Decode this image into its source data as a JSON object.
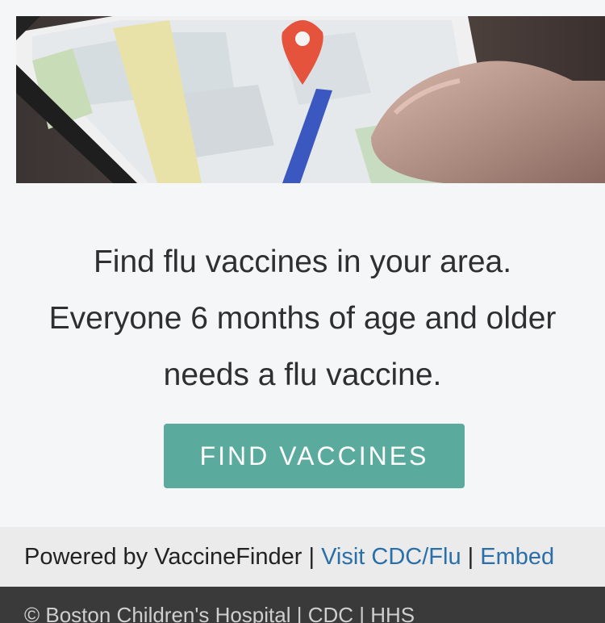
{
  "hero": {
    "image": "phone-map-hero"
  },
  "message": {
    "line1": "Find flu vaccines in your area.",
    "line2": "Everyone 6 months of age and older",
    "line3": "needs a flu vaccine."
  },
  "cta": {
    "label": "FIND VACCINES",
    "color": "#5aab9d"
  },
  "powered_bar": {
    "prefix": "Powered by VaccineFinder",
    "sep1": " | ",
    "link_cdc": "Visit CDC/Flu",
    "sep2": " | ",
    "link_embed": "Embed"
  },
  "footer": {
    "text": "© Boston Children's Hospital | CDC | HHS"
  }
}
